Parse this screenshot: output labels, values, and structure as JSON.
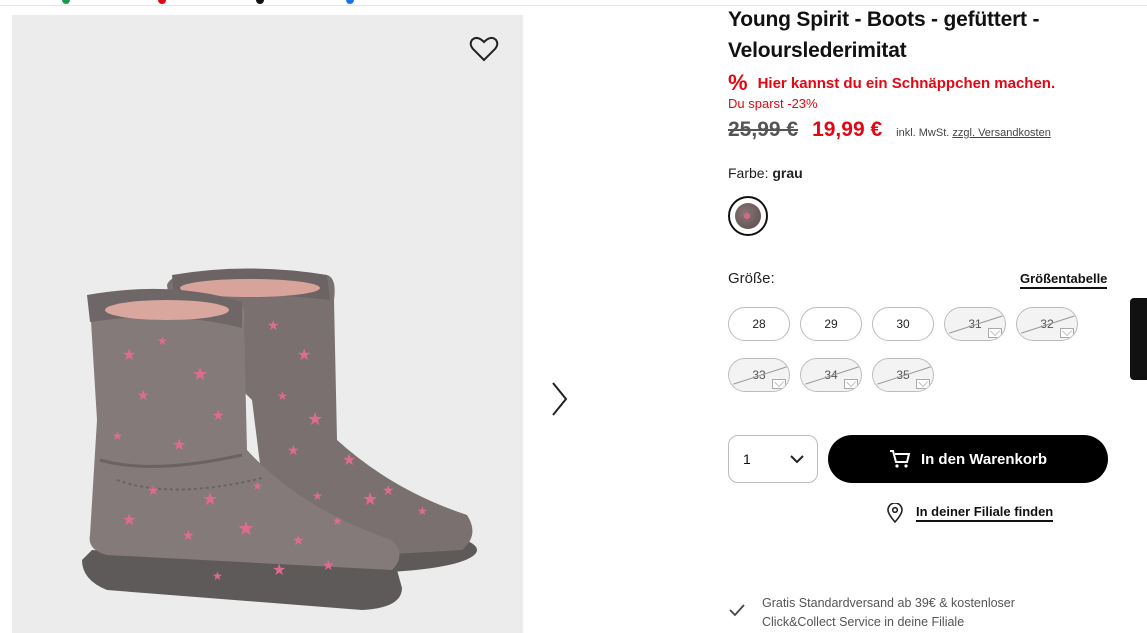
{
  "product": {
    "title": "Young Spirit - Boots - gefüttert - Velourslederimitat",
    "deal_text": "Hier kannst du ein Schnäppchen machen.",
    "deal_icon": "%",
    "savings": "Du sparst -23%",
    "old_price": "25,99 €",
    "new_price": "19,99 €",
    "tax_text": "inkl. MwSt.",
    "shipping_link": "zzgl. Versandkosten"
  },
  "color": {
    "label": "Farbe:",
    "value": "grau"
  },
  "sizes": {
    "label": "Größe:",
    "table_link": "Größentabelle",
    "options": [
      {
        "label": "28",
        "available": true
      },
      {
        "label": "29",
        "available": true
      },
      {
        "label": "30",
        "available": true
      },
      {
        "label": "31",
        "available": false
      },
      {
        "label": "32",
        "available": false
      },
      {
        "label": "33",
        "available": false
      },
      {
        "label": "34",
        "available": false
      },
      {
        "label": "35",
        "available": false
      }
    ]
  },
  "purchase": {
    "quantity": "1",
    "add_to_cart": "In den Warenkorb",
    "find_in_store": "In deiner Filiale finden"
  },
  "shipping_info": "Gratis Standardversand ab 39€ & kostenloser Click&Collect Service in deine Filiale",
  "colors": {
    "accent_red": "#e30613",
    "button_black": "#000000"
  },
  "icons": {
    "favorite": "heart-icon",
    "next": "chevron-right-icon",
    "deal": "percent-icon",
    "dropdown": "chevron-down-icon",
    "cart": "cart-icon",
    "store": "location-pin-icon",
    "check": "checkmark-icon"
  }
}
